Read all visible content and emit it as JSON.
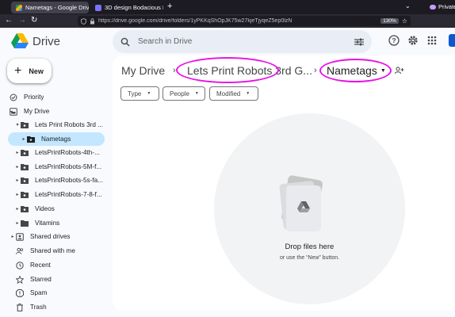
{
  "browser": {
    "tabs": [
      {
        "title": "Nametags - Google Drive",
        "active": true
      },
      {
        "title": "3D design Bodacious Bru",
        "active": false
      }
    ],
    "private_label": "Private",
    "url": "https://drive.google.com/drive/folders/1yPKKqShOpJK75w27kjeTjyqeZ5ep0lzN",
    "zoom": "130%"
  },
  "header": {
    "brand": "Drive",
    "search_placeholder": "Search in Drive"
  },
  "sidebar": {
    "new_label": "New",
    "items": [
      {
        "label": "Priority",
        "icon": "priority-icon"
      },
      {
        "label": "My Drive",
        "icon": "my-drive-icon"
      },
      {
        "label": "Lets Print Robots 3rd ...",
        "icon": "shared-folder-icon"
      },
      {
        "label": "Nametags",
        "icon": "shared-folder-icon"
      },
      {
        "label": "LetsPrintRobots-4th-...",
        "icon": "shared-folder-icon"
      },
      {
        "label": "LetsPrintRobots-5M-f...",
        "icon": "shared-folder-icon"
      },
      {
        "label": "LetsPrintRobots-5s-fa...",
        "icon": "shared-folder-icon"
      },
      {
        "label": "LetsPrintRobots-7-8-f...",
        "icon": "shared-folder-icon"
      },
      {
        "label": "Videos",
        "icon": "shared-folder-icon"
      },
      {
        "label": "Vitamins",
        "icon": "folder-icon"
      },
      {
        "label": "Shared drives",
        "icon": "shared-drives-icon"
      },
      {
        "label": "Shared with me",
        "icon": "people-icon"
      },
      {
        "label": "Recent",
        "icon": "clock-icon"
      },
      {
        "label": "Starred",
        "icon": "star-icon"
      },
      {
        "label": "Spam",
        "icon": "spam-icon"
      },
      {
        "label": "Trash",
        "icon": "trash-icon"
      }
    ]
  },
  "breadcrumb": {
    "root": "My Drive",
    "parent": "Lets Print Robots 3rd G...",
    "current": "Nametags"
  },
  "filters": {
    "type": "Type",
    "people": "People",
    "modified": "Modified"
  },
  "empty_state": {
    "title": "Drop files here",
    "subtitle": "or use the “New” button."
  },
  "colors": {
    "accent": "#0b57d0",
    "selected": "#c2e7ff",
    "annotation": "#e811e8"
  }
}
